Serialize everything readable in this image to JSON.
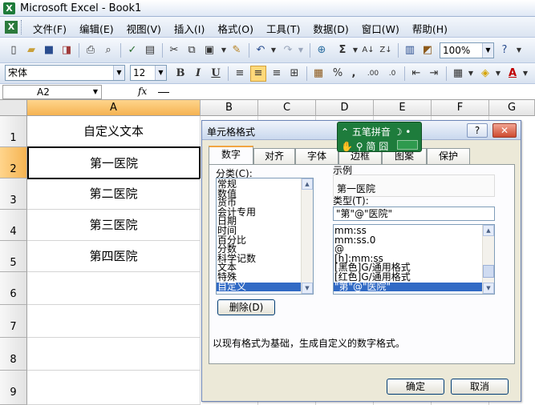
{
  "window": {
    "title": "Microsoft Excel - Book1"
  },
  "menu": [
    "文件(F)",
    "编辑(E)",
    "视图(V)",
    "插入(I)",
    "格式(O)",
    "工具(T)",
    "数据(D)",
    "窗口(W)",
    "帮助(H)"
  ],
  "toolbar": {
    "zoom": "100%"
  },
  "format_toolbar": {
    "font": "宋体",
    "size": "12",
    "bold": "B",
    "italic": "I",
    "underline": "U",
    "percent": "%",
    "comma": ",",
    "align_center_active": true
  },
  "formula_bar": {
    "name_box": "A2",
    "fx": "fx",
    "content": "—"
  },
  "columns": [
    "A",
    "B",
    "C",
    "D",
    "E",
    "F",
    "G"
  ],
  "rows": [
    "1",
    "2",
    "3",
    "4",
    "5",
    "6",
    "7",
    "8",
    "9"
  ],
  "cells": [
    "自定义文本",
    "第一医院",
    "第二医院",
    "第三医院",
    "第四医院",
    "",
    "",
    "",
    ""
  ],
  "dialog": {
    "title": "单元格格式",
    "help": "?",
    "close": "✕",
    "tabs": [
      "数字",
      "对齐",
      "字体",
      "边框",
      "图案",
      "保护"
    ],
    "category_label": "分类(C):",
    "categories": [
      "常规",
      "数值",
      "货币",
      "会计专用",
      "日期",
      "时间",
      "百分比",
      "分数",
      "科学记数",
      "文本",
      "特殊",
      "自定义"
    ],
    "sample_label": "示例",
    "sample_value": "第一医院",
    "type_label": "类型(T):",
    "type_value": "\"第\"@\"医院\"",
    "types": [
      "mm:ss",
      "mm:ss.0",
      "@",
      "[h]:mm:ss",
      "[黑色]G/通用格式",
      "[红色]G/通用格式",
      "\"第\"@\"医院\""
    ],
    "delete_button": "删除(D)",
    "description": "以现有格式为基础，生成自定义的数字格式。",
    "ok_button": "确定",
    "cancel_button": "取消"
  },
  "ime": {
    "row1": "五笔拼音",
    "row2": "简 囧"
  }
}
